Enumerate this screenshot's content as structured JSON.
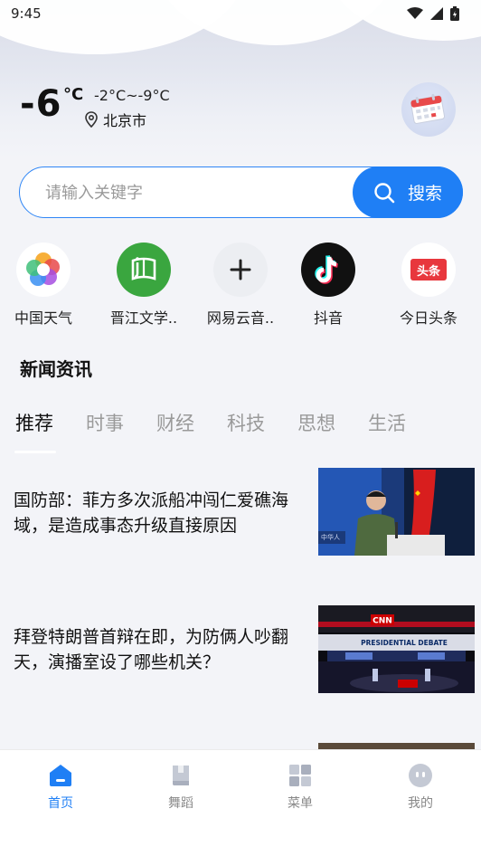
{
  "status_bar": {
    "time": "9:45"
  },
  "weather": {
    "temperature": "-6",
    "unit": "°C",
    "range": "-2°C~-9°C",
    "location": "北京市"
  },
  "search": {
    "placeholder": "请输入关键字",
    "button_label": "搜索"
  },
  "apps": [
    {
      "label": "中国天气",
      "icon": "china-weather-icon"
    },
    {
      "label": "晋江文学..",
      "icon": "jinjiang-literature-icon"
    },
    {
      "label": "网易云音..",
      "icon": "add-icon"
    },
    {
      "label": "抖音",
      "icon": "douyin-icon"
    },
    {
      "label": "今日头条",
      "icon": "toutiao-icon",
      "icon_text": "头条"
    }
  ],
  "news_section": {
    "title": "新闻资讯",
    "tabs": [
      "推荐",
      "时事",
      "财经",
      "科技",
      "思想",
      "生活"
    ],
    "active_tab": "推荐",
    "items": [
      {
        "title": "国防部：菲方多次派船冲闯仁爱礁海域，是造成事态升级直接原因",
        "thumbnail": "defense-press-conference-photo"
      },
      {
        "title": "拜登特朗普首辩在即，为防俩人吵翻天，演播室设了哪些机关？",
        "thumbnail": "cnn-debate-studio-photo",
        "thumbnail_text": [
          "CNN",
          "PRESIDENTIAL DEBATE"
        ]
      }
    ]
  },
  "tab_bar": {
    "items": [
      {
        "label": "首页",
        "icon": "home-icon",
        "active": true
      },
      {
        "label": "舞蹈",
        "icon": "book-icon",
        "active": false
      },
      {
        "label": "菜单",
        "icon": "menu-grid-icon",
        "active": false
      },
      {
        "label": "我的",
        "icon": "profile-icon",
        "active": false
      }
    ]
  },
  "colors": {
    "accent": "#1f7ff5",
    "background": "#f3f4f8"
  }
}
